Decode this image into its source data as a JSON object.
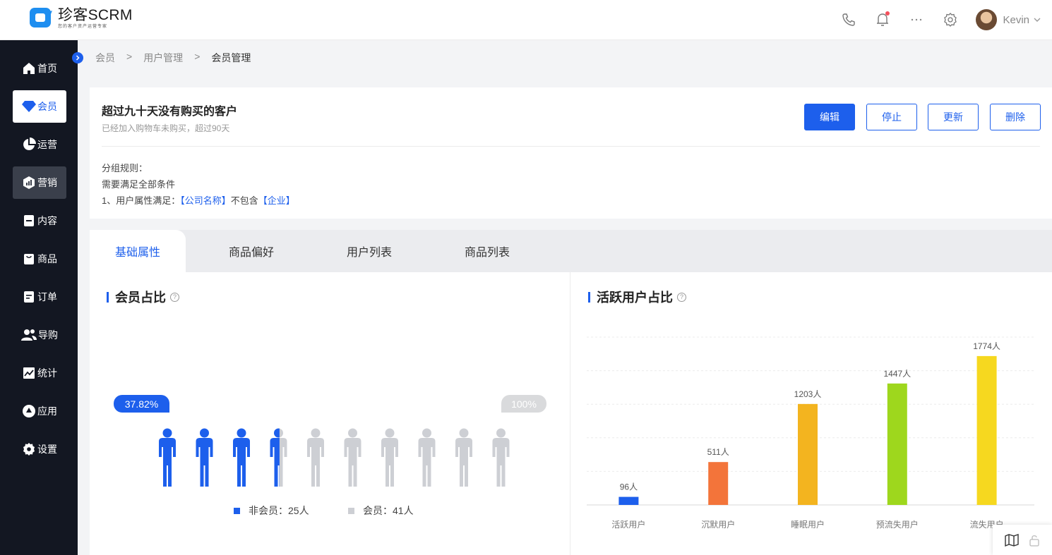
{
  "app": {
    "name": "珍客SCRM",
    "slogan": "您的客户资产运营专家"
  },
  "header": {
    "user_name": "Kevin",
    "icons": [
      "phone-icon",
      "bell-icon",
      "more-icon",
      "settings-icon",
      "avatar",
      "chevron-down-icon"
    ]
  },
  "sidebar": {
    "items": [
      {
        "label": "首页",
        "icon": "home-icon"
      },
      {
        "label": "会员",
        "icon": "diamond-icon"
      },
      {
        "label": "运营",
        "icon": "pie-icon"
      },
      {
        "label": "营销",
        "icon": "marketing-icon"
      },
      {
        "label": "内容",
        "icon": "content-icon"
      },
      {
        "label": "商品",
        "icon": "goods-icon"
      },
      {
        "label": "订单",
        "icon": "order-icon"
      },
      {
        "label": "导购",
        "icon": "guide-icon"
      },
      {
        "label": "统计",
        "icon": "stats-icon"
      },
      {
        "label": "应用",
        "icon": "apps-icon"
      },
      {
        "label": "设置",
        "icon": "settings-icon"
      }
    ]
  },
  "breadcrumb": {
    "items": [
      "会员",
      "用户管理",
      "会员管理"
    ],
    "separator": ">"
  },
  "segment": {
    "title": "超过九十天没有购买的客户",
    "subtitle": "已经加入购物车未购买，超过90天",
    "buttons": {
      "edit": "编辑",
      "stop": "停止",
      "update": "更新",
      "delete": "删除"
    },
    "rules": {
      "label": "分组规则：",
      "condition": "需要满足全部条件",
      "rule_prefix": "1、用户属性满足：",
      "rule_field": "【公司名称】",
      "rule_op": "不包含",
      "rule_value": "【企业】"
    }
  },
  "tabs": [
    "基础属性",
    "商品偏好",
    "用户列表",
    "商品列表"
  ],
  "member_ratio": {
    "title": "会员占比",
    "help": "?",
    "percent_label": "37.82%",
    "max_label": "100%",
    "percent": 37.82,
    "figure_count": 10,
    "legend": [
      {
        "label": "非会员：25人",
        "color": "#1d5fec"
      },
      {
        "label": "会员：41人",
        "color": "#cdcfd4"
      }
    ]
  },
  "active_users": {
    "title": "活跃用户占比",
    "help": "?"
  },
  "chart_data": {
    "type": "bar",
    "categories": [
      "活跃用户",
      "沉默用户",
      "睡眠用户",
      "预流失用户",
      "流失用户"
    ],
    "values": [
      96,
      511,
      1203,
      1447,
      1774
    ],
    "data_labels": [
      "96人",
      "511人",
      "1203人",
      "1447人",
      "1774人"
    ],
    "colors": [
      "#1d5fec",
      "#f3743a",
      "#f3b41f",
      "#9ed71d",
      "#f6d81f"
    ],
    "ylim": [
      0,
      2000
    ],
    "grid": true,
    "legend": "none"
  },
  "accent": "#1d5fec"
}
